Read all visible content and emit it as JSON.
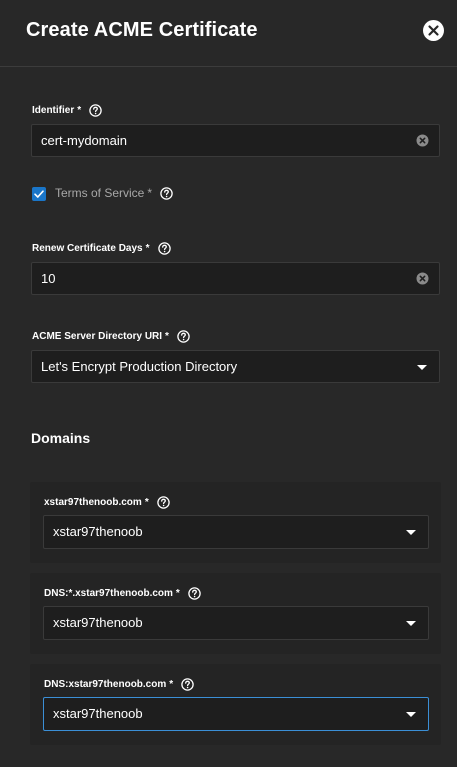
{
  "dialog": {
    "title": "Create ACME Certificate"
  },
  "identifier": {
    "label": "Identifier",
    "required_mark": "*",
    "value": "cert-mydomain"
  },
  "terms": {
    "label": "Terms of Service",
    "required_mark": "*",
    "checked": true
  },
  "renew_days": {
    "label": "Renew Certificate Days",
    "required_mark": "*",
    "value": "10"
  },
  "directory_uri": {
    "label": "ACME Server Directory URI",
    "required_mark": "*",
    "selected": "Let's Encrypt Production Directory"
  },
  "domains": {
    "title": "Domains",
    "items": [
      {
        "label": "xstar97thenoob.com",
        "required_mark": "*",
        "selected": "xstar97thenoob"
      },
      {
        "label": "DNS:*.xstar97thenoob.com",
        "required_mark": "*",
        "selected": "xstar97thenoob"
      },
      {
        "label": "DNS:xstar97thenoob.com",
        "required_mark": "*",
        "selected": "xstar97thenoob"
      }
    ]
  },
  "colors": {
    "background": "#282828",
    "input_bg": "#1e1e1e",
    "accent": "#1a76c9",
    "focus_border": "#3b8fd6"
  }
}
